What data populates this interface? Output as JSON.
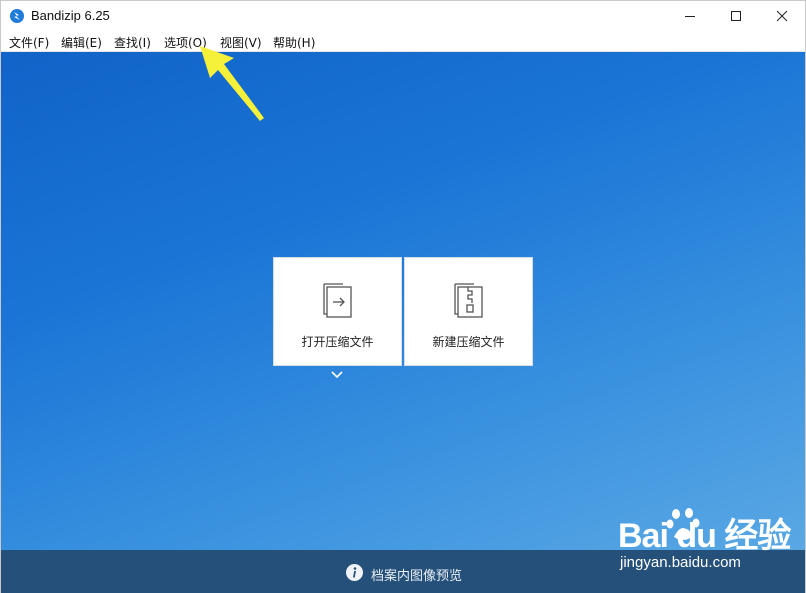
{
  "window": {
    "title": "Bandizip 6.25"
  },
  "menu": [
    {
      "label": "文件(F)"
    },
    {
      "label": "编辑(E)"
    },
    {
      "label": "查找(I)"
    },
    {
      "label": "选项(O)"
    },
    {
      "label": "视图(V)"
    },
    {
      "label": "帮助(H)"
    }
  ],
  "tiles": {
    "open": {
      "label": "打开压缩文件",
      "icon": "open-archive-icon"
    },
    "new": {
      "label": "新建压缩文件",
      "icon": "new-archive-icon"
    }
  },
  "bottombar": {
    "text": "档案内图像预览",
    "icon": "info-icon"
  },
  "watermark": {
    "brand": "Bai du 经验",
    "url": "jingyan.baidu.com"
  },
  "colors": {
    "accent": "#1a75d6",
    "bottombar": "#25507a",
    "arrow": "#f5f03a"
  }
}
